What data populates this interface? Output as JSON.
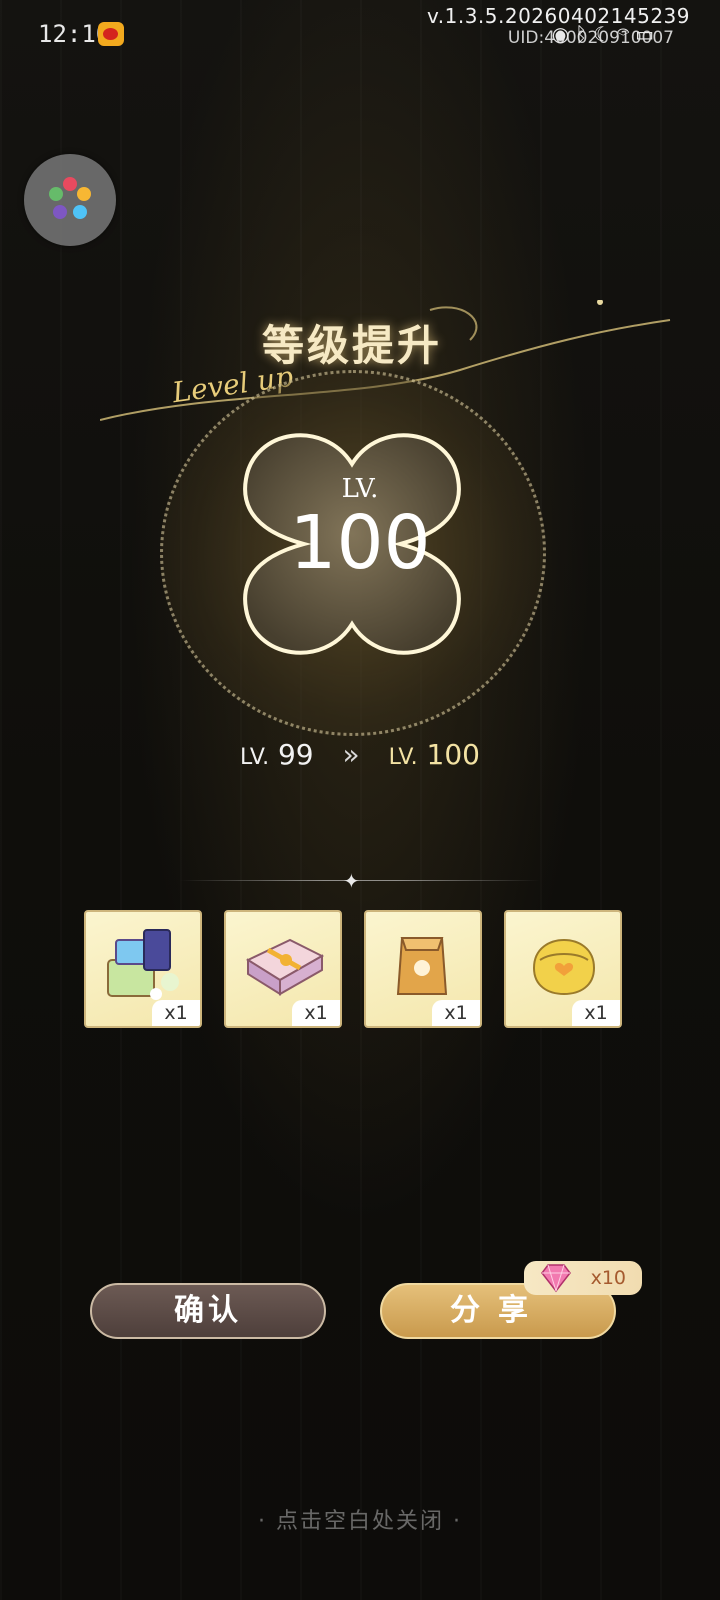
{
  "status_bar": {
    "time": "12:10",
    "version": "v.1.3.5.20260402145239",
    "uid": "UID:400020910007",
    "icons": [
      "eye-icon",
      "bluetooth-icon",
      "moon-icon",
      "wifi-icon",
      "signal-icon",
      "battery-icon"
    ]
  },
  "levelup": {
    "title": "等级提升",
    "subtitle": "Level up",
    "lv_prefix": "LV.",
    "level": "100",
    "from_prefix": "LV.",
    "from_level": "99",
    "arrow": "»",
    "to_prefix": "LV.",
    "to_level": "100"
  },
  "rewards": [
    {
      "icon": "gift-pack-icon",
      "qty": "x1"
    },
    {
      "icon": "gift-box-icon",
      "qty": "x1"
    },
    {
      "icon": "paper-bag-icon",
      "qty": "x1"
    },
    {
      "icon": "coin-purse-icon",
      "qty": "x1"
    }
  ],
  "buttons": {
    "confirm": "确认",
    "share": "分享"
  },
  "share_bonus": {
    "icon": "pink-diamond-icon",
    "qty": "x10"
  },
  "close_hint": "· 点击空白处关闭 ·",
  "colors": {
    "background": "#11100d",
    "gold_text": "#f3e2a3",
    "share_button": "#d9ae62",
    "confirm_button": "#5d4c47"
  }
}
